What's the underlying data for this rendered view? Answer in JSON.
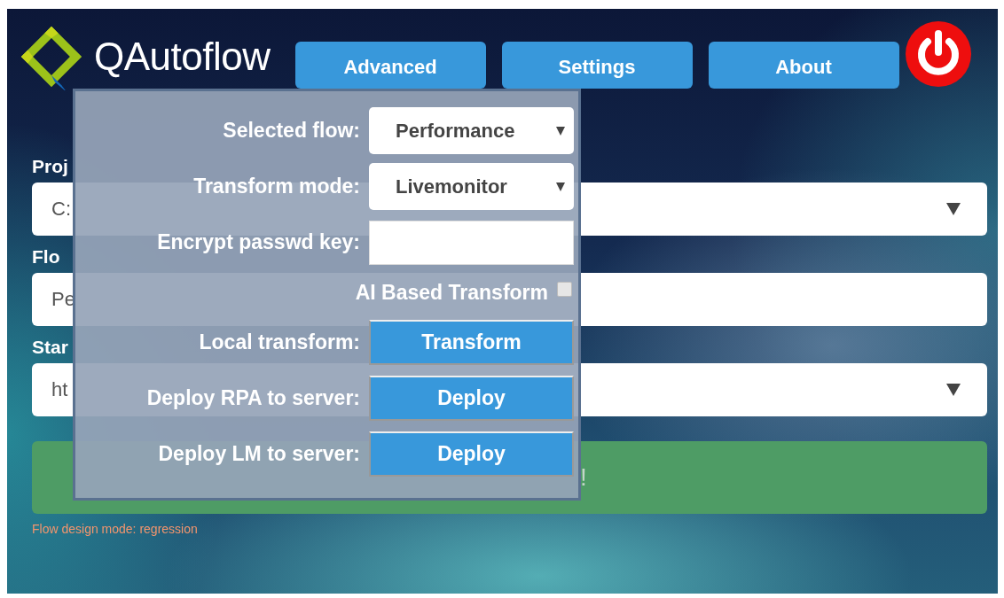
{
  "header": {
    "logo_text": "**QA**utoflow"
  },
  "nav": [
    {
      "label": "Advanced"
    },
    {
      "label": "Settings"
    },
    {
      "label": "About"
    }
  ],
  "form": {
    "fields": [
      {
        "label": "Proj",
        "value": "C:",
        "kind": "select"
      },
      {
        "label": "Flo",
        "value": "Pe",
        "kind": "text"
      },
      {
        "label": "Star",
        "value": "ht",
        "kind": "select"
      }
    ],
    "start_button": "!",
    "status": "Flow design mode: regression"
  },
  "advanced_panel": {
    "rows": [
      {
        "kind": "select",
        "label": "Selected flow:",
        "value": "Performance"
      },
      {
        "kind": "select",
        "label": "Transform mode:",
        "value": "Livemonitor"
      },
      {
        "kind": "input",
        "label": "Encrypt passwd key:"
      },
      {
        "kind": "checkbox",
        "label": "AI Based Transform",
        "checked": false
      },
      {
        "kind": "button",
        "label": "Local transform:",
        "button": "Transform"
      },
      {
        "kind": "button",
        "label": "Deploy RPA to server:",
        "button": "Deploy"
      },
      {
        "kind": "button",
        "label": "Deploy LM to server:",
        "button": "Deploy"
      }
    ]
  }
}
